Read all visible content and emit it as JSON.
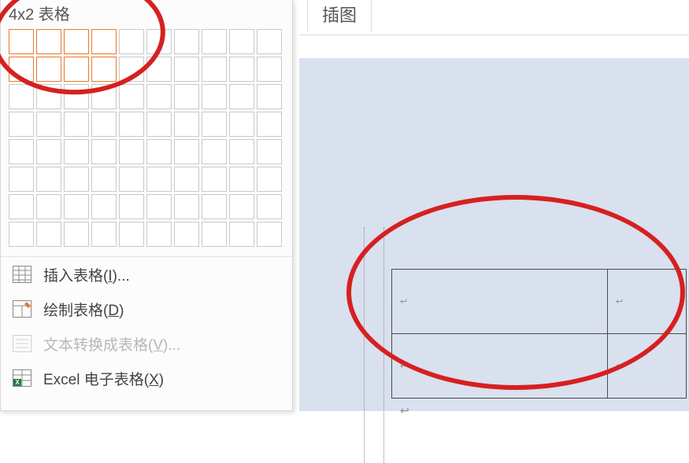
{
  "panel": {
    "title": "4x2 表格",
    "grid": {
      "cols": 10,
      "rows": 8,
      "sel_cols": 4,
      "sel_rows": 2
    }
  },
  "menu": {
    "insert_table": "插入表格(I)...",
    "draw_table": "绘制表格(D)",
    "text_to_table": "文本转换成表格(V)...",
    "excel_table": "Excel 电子表格(X)"
  },
  "ribbon": {
    "tab_label": "插图"
  },
  "preview": {
    "rows": 2,
    "cols": 2,
    "cell_mark": "↩",
    "para_mark": "↩"
  },
  "annotations": [
    {
      "name": "grid-selection-highlight"
    },
    {
      "name": "table-preview-highlight"
    }
  ]
}
